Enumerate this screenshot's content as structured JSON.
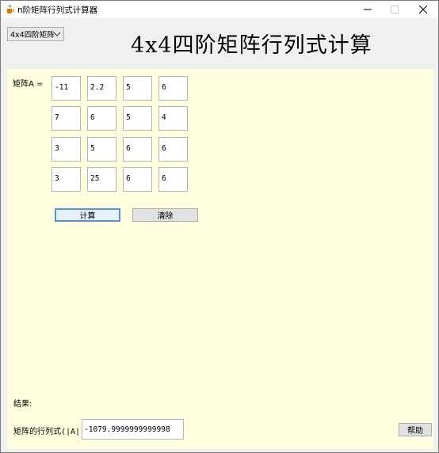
{
  "window": {
    "title": "n阶矩阵行列式计算器"
  },
  "header": {
    "order_select_value": "4x4四阶矩阵",
    "title": "4x4四阶矩阵行列式计算"
  },
  "matrix": {
    "label": "矩阵A =",
    "rows": [
      [
        "-11",
        "2.2",
        "5",
        "6"
      ],
      [
        "7",
        "6",
        "5",
        "4"
      ],
      [
        "3",
        "5",
        "6",
        "6"
      ],
      [
        "3",
        "25",
        "6",
        "6"
      ]
    ]
  },
  "buttons": {
    "calculate": "计算",
    "clear": "清除",
    "help": "帮助"
  },
  "result": {
    "label": "结果:",
    "det_label": "矩阵的行列式(|A|)=",
    "det_value": "-1079.9999999999998"
  },
  "icons": {
    "app": "java-cup-icon",
    "minimize": "minimize-icon",
    "maximize": "maximize-icon",
    "close": "close-icon",
    "dropdown": "chevron-down-icon"
  }
}
